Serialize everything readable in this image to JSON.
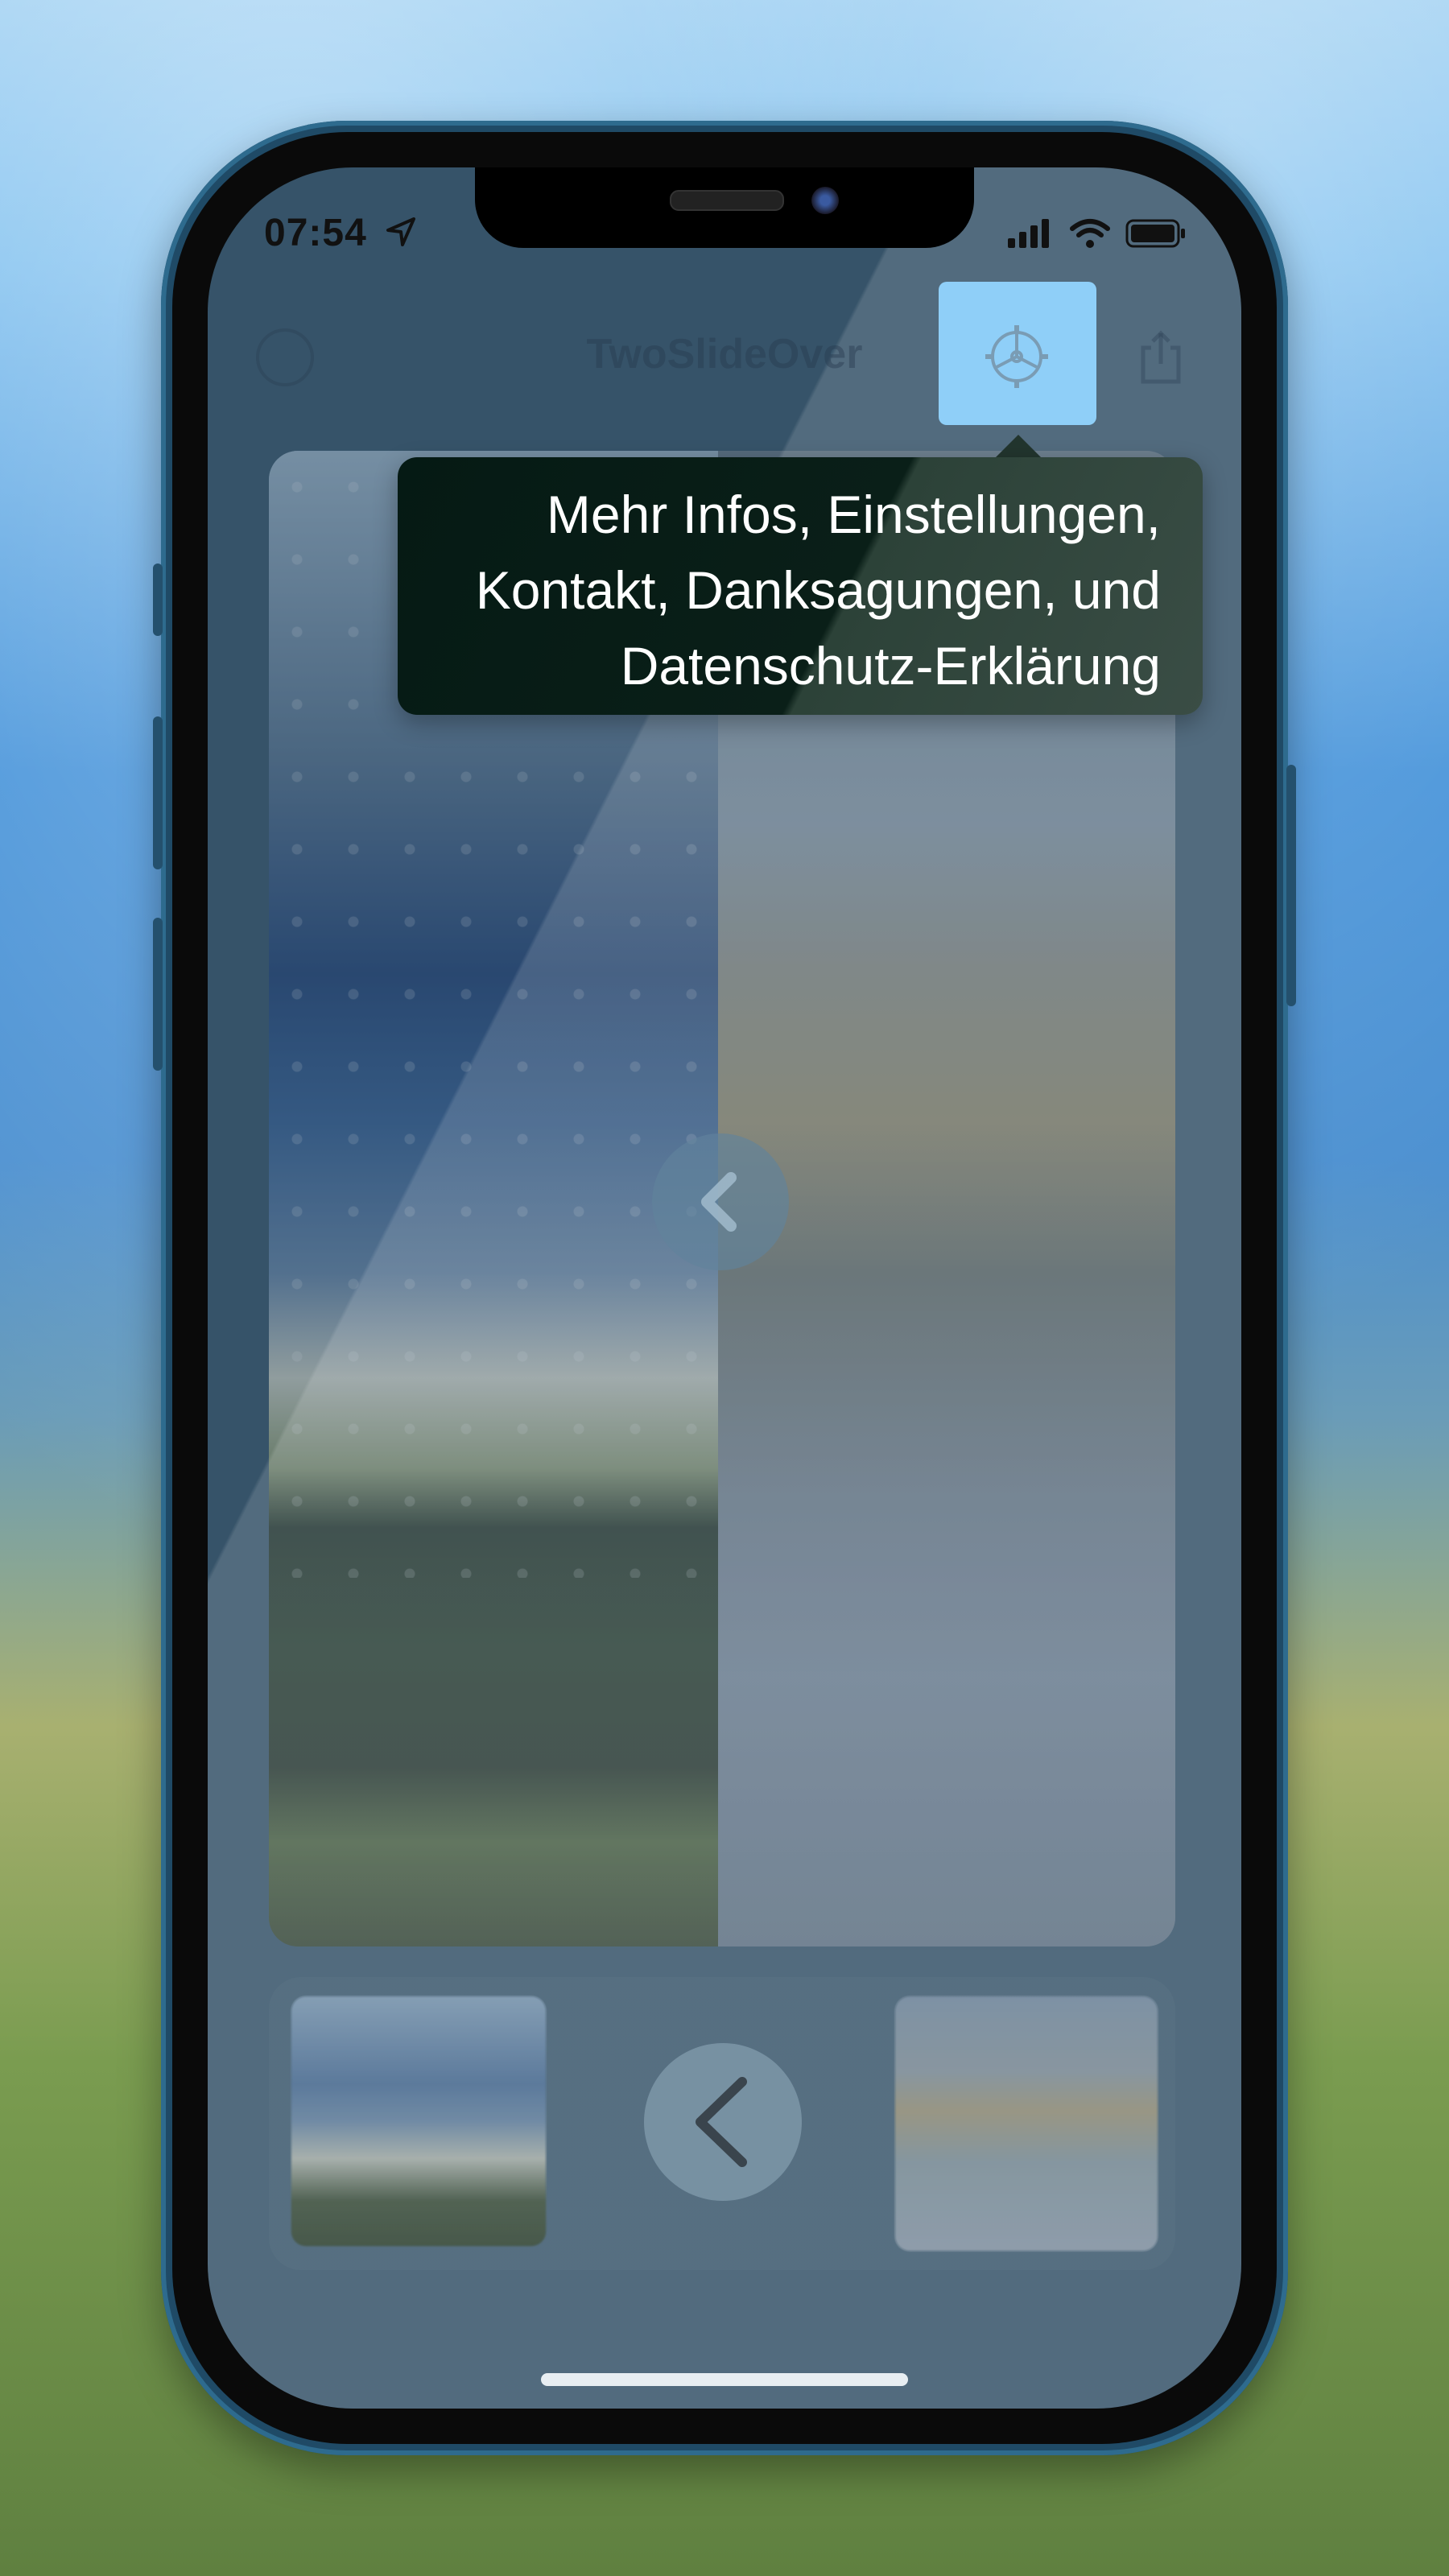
{
  "status_bar": {
    "time": "07:54"
  },
  "nav": {
    "title": "TwoSlideOver"
  },
  "tooltip": {
    "lines": [
      "Mehr Infos, Einstellungen,",
      "Kontakt, Danksagungen, und",
      "Datenschutz-Erklärung"
    ]
  },
  "colors": {
    "highlight": "#8fcff8",
    "tooltip_bg": "#051a14",
    "tooltip_text": "#ffffff"
  },
  "icons": {
    "settings": "gear-icon",
    "help": "question-circle-icon",
    "share": "share-icon",
    "compare": "chevron-left-icon",
    "swap": "chevron-left-icon"
  }
}
